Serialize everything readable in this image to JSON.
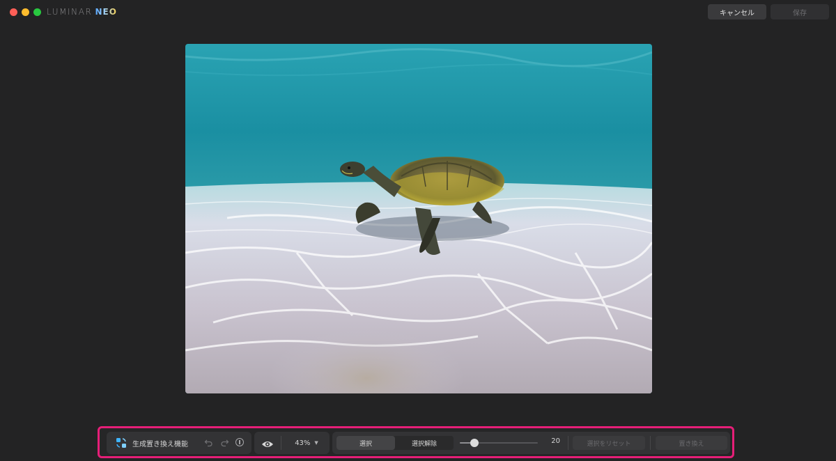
{
  "titlebar": {
    "logo_left": "LUMINAR",
    "logo_right": "NEO",
    "cancel_label": "キャンセル",
    "save_label": "保存"
  },
  "toolbar": {
    "tool_label": "生成置き換え機能",
    "zoom": "43%",
    "select_label": "選択",
    "deselect_label": "選択解除",
    "brush_size": "20",
    "brush_size_fraction": 0.15,
    "reset_label": "選択をリセット",
    "replace_label": "置き換え"
  },
  "icons": {
    "tool": "generative-replace-icon",
    "undo": "undo-icon",
    "redo": "redo-icon",
    "info": "info-icon",
    "eye": "eye-icon",
    "zoom_chevron": "chevron-down-icon"
  },
  "colors": {
    "highlight_frame": "#e61e78",
    "accent_blue": "#5aa8ff"
  }
}
